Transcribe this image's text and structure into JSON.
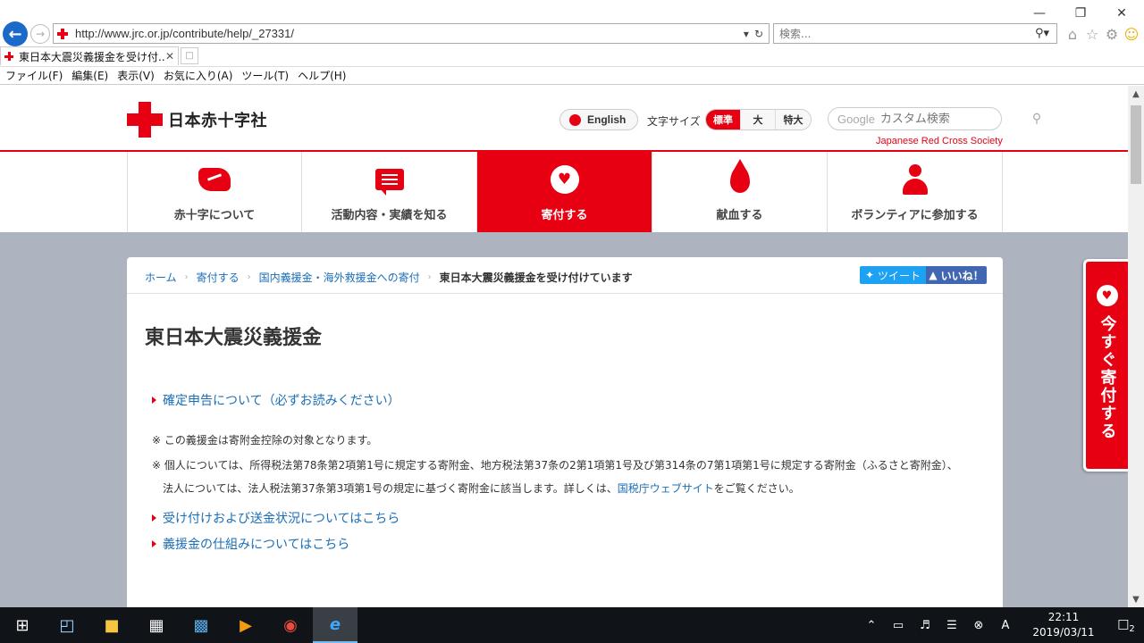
{
  "browser": {
    "url": "http://www.jrc.or.jp/contribute/help/_27331/",
    "search_placeholder": "検索...",
    "tab_title": "東日本大震災義援金を受け付...",
    "menu": [
      "ファイル(F)",
      "編集(E)",
      "表示(V)",
      "お気に入り(A)",
      "ツール(T)",
      "ヘルプ(H)"
    ]
  },
  "site": {
    "logo_text": "日本赤十字社",
    "english_label": "English",
    "fontsize_label": "文字サイズ",
    "fontsize_options": [
      "標準",
      "大",
      "特大"
    ],
    "search_placeholder": "カスタム検索",
    "search_brand": "Google",
    "en_name": "Japanese Red Cross Society",
    "brand_color": "#e60012"
  },
  "nav": [
    {
      "label": "赤十字について",
      "icon": "handshake-icon"
    },
    {
      "label": "活動内容・実績を知る",
      "icon": "chat-icon"
    },
    {
      "label": "寄付する",
      "icon": "heart-icon"
    },
    {
      "label": "献血する",
      "icon": "blood-drop-icon"
    },
    {
      "label": "ボランティアに参加する",
      "icon": "person-icon"
    }
  ],
  "breadcrumb": {
    "items": [
      "ホーム",
      "寄付する",
      "国内義援金・海外救援金への寄付"
    ],
    "current": "東日本大震災義援金を受け付けています"
  },
  "social": {
    "tweet": "ツイート",
    "like": "いいね！"
  },
  "page": {
    "title": "東日本大震災義援金",
    "link_tax": "確定申告について（必ずお読みください）",
    "note1": "※ この義援金は寄附金控除の対象となります。",
    "note2": "※ 個人については、所得税法第78条第2項第1号に規定する寄附金、地方税法第37条の2第1項第1号及び第314条の7第1項第1号に規定する寄附金（ふるさと寄附金）、",
    "note3_pre": "法人については、法人税法第37条第3項第1号の規定に基づく寄附金に該当します。詳しくは、",
    "note3_link": "国税庁ウェブサイト",
    "note3_post": "をご覧ください。",
    "link_status": "受け付けおよび送金状況についてはこちら",
    "link_mechanism": "義援金の仕組みについてはこちら"
  },
  "donate_now": "今すぐ寄付する",
  "taskbar": {
    "time": "22:11",
    "date": "2019/03/11",
    "notifications": "2"
  }
}
